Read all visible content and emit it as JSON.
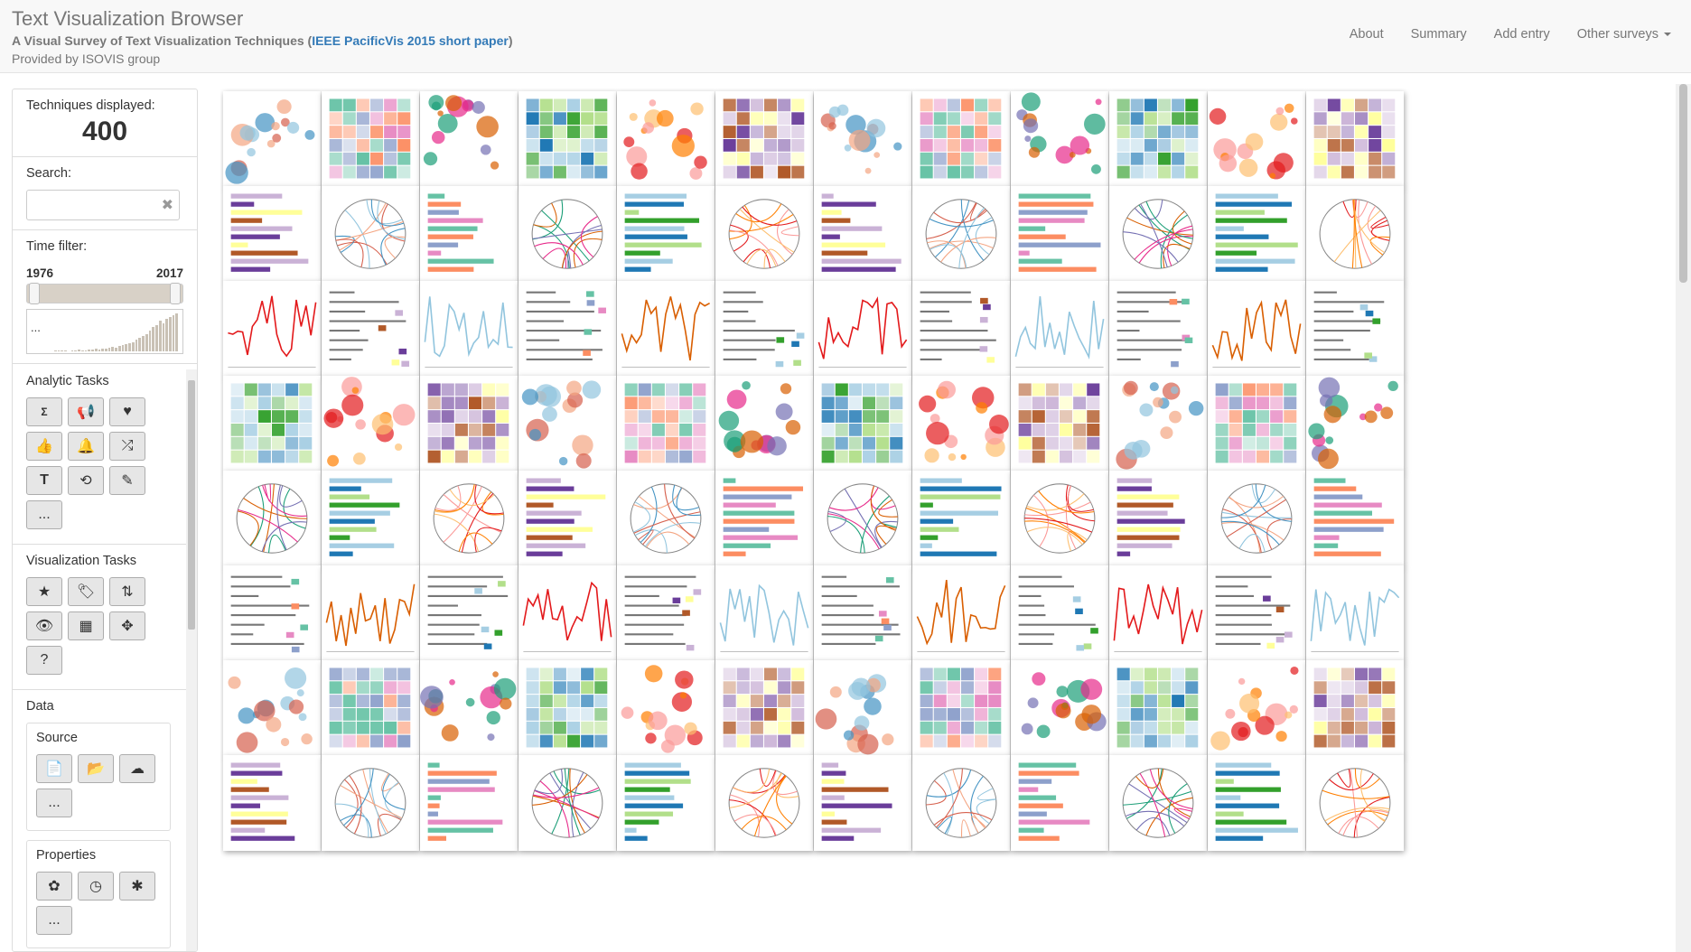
{
  "header": {
    "title": "Text Visualization Browser",
    "subtitle_pre": "A Visual Survey of Text Visualization Techniques (",
    "subtitle_link": "IEEE PacificVis 2015 short paper",
    "subtitle_post": ")",
    "provider": "Provided by ISOVIS group",
    "nav": [
      "About",
      "Summary",
      "Add entry",
      "Other surveys"
    ]
  },
  "sidebar": {
    "techniques_label": "Techniques displayed:",
    "techniques_count": "400",
    "search_label": "Search:",
    "search_value": "",
    "time_label": "Time filter:",
    "year_start": "1976",
    "year_end": "2017",
    "hist_more": "...",
    "histogram": [
      1,
      1,
      1,
      1,
      0,
      1,
      1,
      2,
      1,
      1,
      2,
      2,
      3,
      2,
      3,
      3,
      4,
      5,
      4,
      6,
      7,
      8,
      9,
      10,
      12,
      14,
      16,
      18,
      22,
      26,
      28,
      32,
      30,
      34,
      36,
      38,
      40
    ],
    "analytic_label": "Analytic Tasks",
    "analytic_icons": [
      "sum-text-icon",
      "megaphone-icon",
      "heart-icon",
      "thumbs-up-icon",
      "bell-icon",
      "shuffle-icon",
      "text-icon",
      "repeat-icon",
      "edit-icon",
      "more-icon"
    ],
    "visualization_label": "Visualization Tasks",
    "visualization_icons": [
      "star-icon",
      "tags-icon",
      "sort-icon",
      "eye-icon",
      "chart-icon",
      "move-icon",
      "question-icon"
    ],
    "data_label": "Data",
    "source_label": "Source",
    "source_icons": [
      "file-icon",
      "folder-icon",
      "cloud-download-icon",
      "more-icon"
    ],
    "properties_label": "Properties",
    "properties_icons": [
      "geo-icon",
      "clock-icon",
      "network-icon",
      "more-icon"
    ],
    "more_text": "..."
  },
  "grid": {
    "rows": 8,
    "cols": 12
  }
}
